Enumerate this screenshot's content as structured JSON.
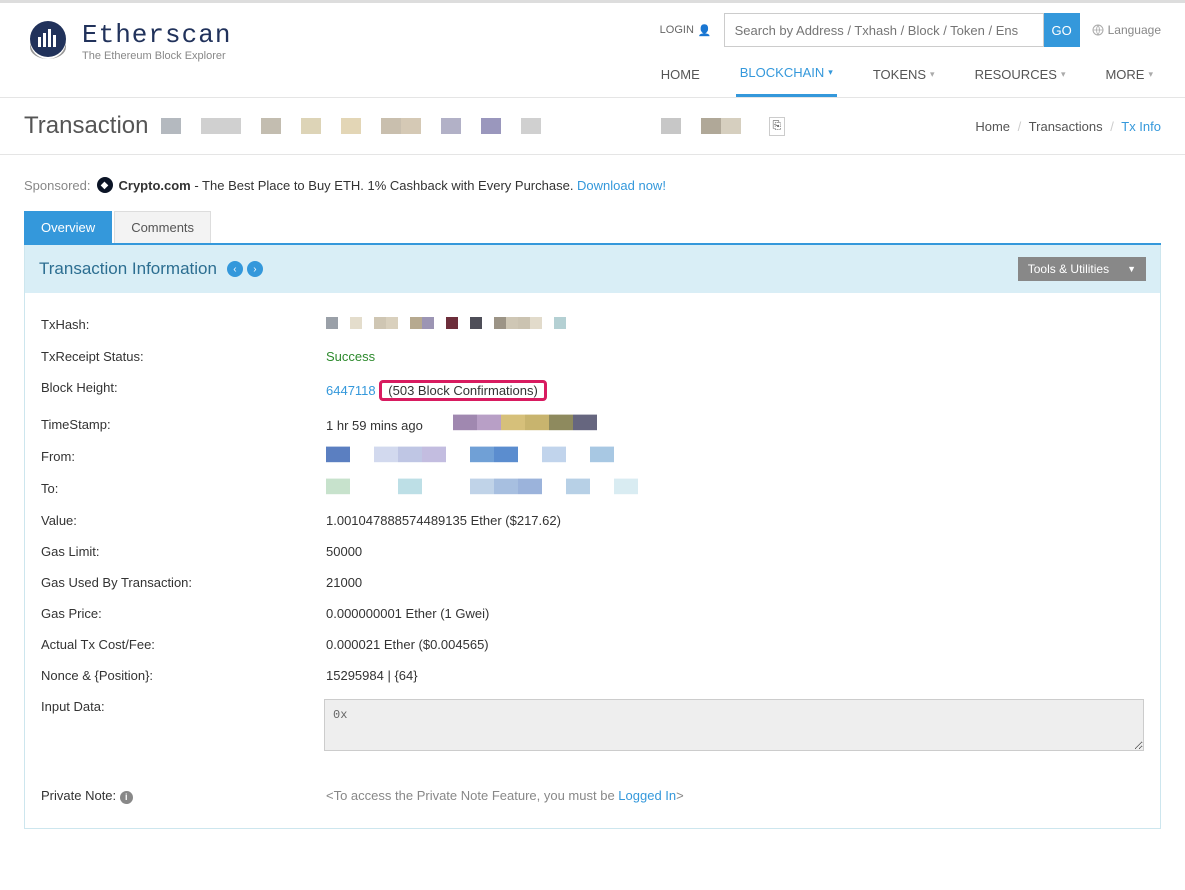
{
  "logo": {
    "title": "Etherscan",
    "subtitle": "The Ethereum Block Explorer"
  },
  "header": {
    "login": "LOGIN",
    "search_placeholder": "Search by Address / Txhash / Block / Token / Ens",
    "go": "GO",
    "language": "Language"
  },
  "nav": {
    "home": "HOME",
    "blockchain": "BLOCKCHAIN",
    "tokens": "TOKENS",
    "resources": "RESOURCES",
    "more": "MORE"
  },
  "title": "Transaction",
  "breadcrumb": {
    "home": "Home",
    "transactions": "Transactions",
    "current": "Tx Info"
  },
  "sponsor": {
    "label": "Sponsored:",
    "brand": "Crypto.com",
    "text": " - The Best Place to Buy ETH. 1% Cashback with Every Purchase. ",
    "cta": "Download now!"
  },
  "tabs": {
    "overview": "Overview",
    "comments": "Comments"
  },
  "panel": {
    "title": "Transaction Information",
    "tools": "Tools & Utilities"
  },
  "fields": {
    "txhash_label": "TxHash:",
    "status_label": "TxReceipt Status:",
    "status_value": "Success",
    "blockheight_label": "Block Height:",
    "blockheight_link": "6447118",
    "blockheight_conf": "(503 Block Confirmations)",
    "timestamp_label": "TimeStamp:",
    "timestamp_value": "1 hr 59 mins ago",
    "from_label": "From:",
    "to_label": "To:",
    "value_label": "Value:",
    "value_value": "1.001047888574489135 Ether ($217.62)",
    "gaslimit_label": "Gas Limit:",
    "gaslimit_value": "50000",
    "gasused_label": "Gas Used By Transaction:",
    "gasused_value": "21000",
    "gasprice_label": "Gas Price:",
    "gasprice_value": "0.000000001 Ether (1 Gwei)",
    "txcost_label": "Actual Tx Cost/Fee:",
    "txcost_value": "0.000021 Ether ($0.004565)",
    "nonce_label": "Nonce & {Position}:",
    "nonce_value": "15295984 | {64}",
    "inputdata_label": "Input Data:",
    "inputdata_value": "0x",
    "privatenote_label": "Private Note:",
    "privatenote_prefix": "<To access the Private Note Feature, you must be ",
    "privatenote_link": "Logged In",
    "privatenote_suffix": ">"
  },
  "strips": {
    "title": [
      "#b4b9bf",
      "#ffffff",
      "#d0d0d0",
      "#d0d0d0",
      "#ffffff",
      "#c3bdb0",
      "#ffffff",
      "#ddd4b7",
      "#ffffff",
      "#e3d6b6",
      "#ffffff",
      "#c9bfae",
      "#d5c9b5",
      "#ffffff",
      "#b2b1c7",
      "#ffffff",
      "#9a97bd",
      "#ffffff",
      "#d0d0d0",
      "#ffffff",
      "#ffffff",
      "#ffffff",
      "#ffffff",
      "#ffffff",
      "#ffffff",
      "#c7c7c7",
      "#ffffff",
      "#b0a898",
      "#d6cfbf",
      "#ffffff"
    ],
    "txhash": [
      "#9aa0a8",
      "#ffffff",
      "#e4ddcc",
      "#ffffff",
      "#cfc6b3",
      "#d9d0bd",
      "#ffffff",
      "#b6a98f",
      "#9c95b4",
      "#ffffff",
      "#6d2e3b",
      "#ffffff",
      "#4e4e58",
      "#ffffff",
      "#9c9486",
      "#cfc7b5",
      "#cbc3b1",
      "#e2dbcb",
      "#ffffff",
      "#b4d0d3"
    ],
    "timestamp": [
      "#a088b0",
      "#b89fc6",
      "#d6c07a",
      "#c8b46e",
      "#8e8a5e",
      "#66667f"
    ],
    "from": [
      "#5b7fc1",
      "#ffffff",
      "#d2d9ee",
      "#bfc6e4",
      "#c3bde0",
      "#ffffff",
      "#70a0d6",
      "#5b8dcf",
      "#ffffff",
      "#c1d4ec",
      "#ffffff",
      "#a8c8e3"
    ],
    "to": [
      "#c7e2cc",
      "#ffffff",
      "#ffffff",
      "#bddfe6",
      "#ffffff",
      "#ffffff",
      "#c0d3e8",
      "#a7bfe0",
      "#9bb3db",
      "#ffffff",
      "#b7d0e6",
      "#ffffff",
      "#d9ecf2"
    ]
  }
}
